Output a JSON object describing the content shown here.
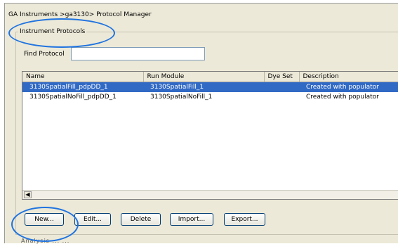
{
  "breadcrumb": "GA Instruments >ga3130> Protocol Manager",
  "group_title": "Instrument Protocols",
  "find": {
    "label": "Find Protocol",
    "value": ""
  },
  "table": {
    "columns": [
      "Name",
      "Run Module",
      "Dye Set",
      "Description"
    ],
    "rows": [
      {
        "name": "3130SpatialFill_pdpDD_1",
        "run_module": "3130SpatialFill_1",
        "dye_set": "",
        "description": "Created with populator",
        "selected": true
      },
      {
        "name": "3130SpatialNoFill_pdpDD_1",
        "run_module": "3130SpatialNoFill_1",
        "dye_set": "",
        "description": "Created with populator",
        "selected": false
      }
    ]
  },
  "buttons": {
    "new": "New...",
    "edit": "Edit...",
    "delete": "Delete",
    "import": "Import...",
    "export": "Export..."
  },
  "footer_text": "Analysis ... ...",
  "colors": {
    "highlight_ellipse": "#1f73e0",
    "selection": "#316ac5",
    "panel": "#ece9d8"
  },
  "icons": {
    "scroll_left": "◀"
  }
}
